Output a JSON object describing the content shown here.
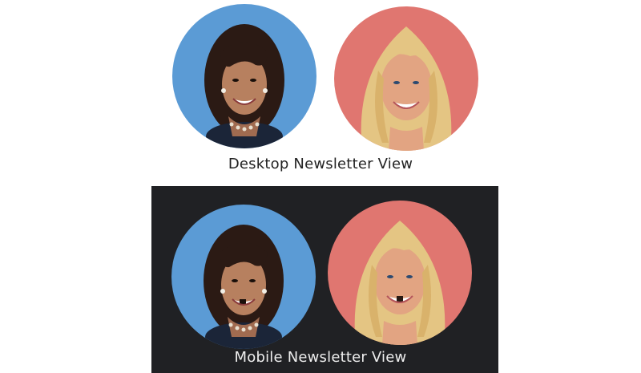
{
  "desktop": {
    "caption": "Desktop Newsletter View",
    "background": "#ffffff",
    "caption_color": "#222222"
  },
  "mobile": {
    "caption": "Mobile Newsletter View",
    "background": "#202124",
    "caption_color": "#eeeeee"
  },
  "portraits": {
    "left_background": "#5b9bd5",
    "right_background": "#e07670"
  }
}
